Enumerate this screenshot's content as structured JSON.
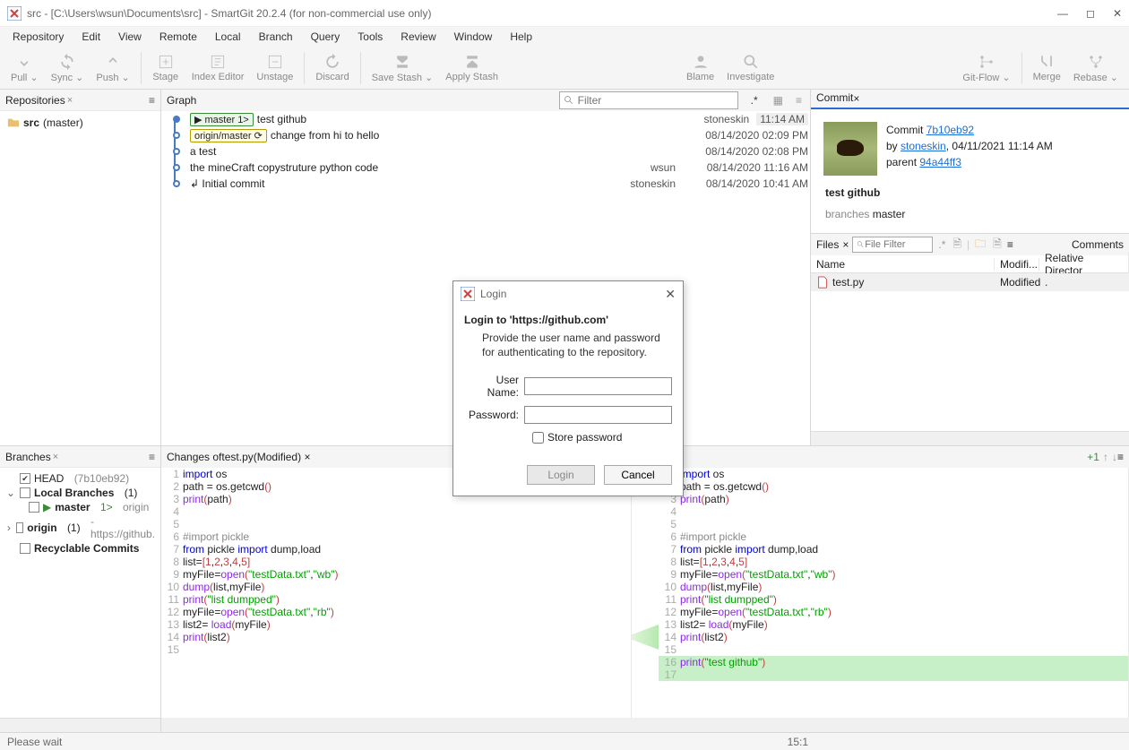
{
  "window": {
    "title": "src - [C:\\Users\\wsun\\Documents\\src] - SmartGit 20.2.4 (for non-commercial use only)"
  },
  "menu": [
    "Repository",
    "Edit",
    "View",
    "Remote",
    "Local",
    "Branch",
    "Query",
    "Tools",
    "Review",
    "Window",
    "Help"
  ],
  "toolbar": {
    "pull": "Pull ⌄",
    "sync": "Sync ⌄",
    "push": "Push ⌄",
    "stage": "Stage",
    "index_editor": "Index Editor",
    "unstage": "Unstage",
    "discard": "Discard",
    "save_stash": "Save Stash ⌄",
    "apply_stash": "Apply Stash",
    "blame": "Blame",
    "investigate": "Investigate",
    "gitflow": "Git-Flow ⌄",
    "merge": "Merge",
    "rebase": "Rebase ⌄"
  },
  "repositories": {
    "title": "Repositories",
    "items": [
      {
        "name": "src",
        "branch": "(master)"
      }
    ]
  },
  "graph": {
    "title": "Graph",
    "filter_placeholder": "Filter",
    "time_badge": "11:14 AM",
    "commits": [
      {
        "tags": [
          "▶ master 1>"
        ],
        "msg": "test github",
        "author": "stoneskin",
        "date": ""
      },
      {
        "tags": [
          "origin/master ⟳"
        ],
        "msg": "change from hi to hello",
        "author": "",
        "date": "08/14/2020 02:09 PM"
      },
      {
        "tags": [],
        "msg": "a test",
        "author": "",
        "date": "08/14/2020 02:08 PM"
      },
      {
        "tags": [],
        "msg": "the mineCraft copystruture python code",
        "author": "wsun",
        "date": "08/14/2020 11:16 AM"
      },
      {
        "tags": [],
        "msg": "↲ Initial commit",
        "author": "stoneskin",
        "date": "08/14/2020 10:41 AM"
      }
    ]
  },
  "commit_panel": {
    "title": "Commit",
    "commit_label": "Commit",
    "commit_hash": "7b10eb92",
    "by_label": "by",
    "author": "stoneskin",
    "date": ", 04/11/2021 11:14 AM",
    "parent_label": "parent",
    "parent_hash": "94a44ff3",
    "subject": "test github",
    "branches_label": "branches",
    "branches_value": "master"
  },
  "files_panel": {
    "title": "Files",
    "filter_placeholder": "File Filter",
    "dotstar": ".*",
    "comments": "Comments",
    "cols": {
      "name": "Name",
      "modifi": "Modifi...",
      "reldir": "Relative Director"
    },
    "rows": [
      {
        "name": "test.py",
        "status": "Modified",
        "reldir": "."
      }
    ]
  },
  "branches": {
    "title": "Branches",
    "head": {
      "label": "HEAD",
      "hash": "(7b10eb92)"
    },
    "local": {
      "label": "Local Branches",
      "count": "(1)"
    },
    "master": {
      "label": "master",
      "ahead": "1>",
      "remote": "origin"
    },
    "origin": {
      "label": "origin",
      "count": "(1)",
      "url": "- https://github."
    },
    "recyclable": "Recyclable Commits"
  },
  "changes": {
    "title_prefix": "Changes of ",
    "file": "test.py",
    "status": " (Modified)",
    "plus_count": "+1"
  },
  "diff": {
    "left": [
      {
        "n": 1,
        "html": "<span class='tok-kw'>import</span> os"
      },
      {
        "n": 2,
        "html": "path = os.getcwd<span class='tok-paren'>()</span>"
      },
      {
        "n": 3,
        "html": "<span class='tok-fn'>print</span><span class='tok-paren'>(</span>path<span class='tok-paren'>)</span>"
      },
      {
        "n": 4,
        "html": ""
      },
      {
        "n": 5,
        "html": ""
      },
      {
        "n": 6,
        "html": "<span class='tok-cmt'>#import pickle</span>"
      },
      {
        "n": 7,
        "html": "<span class='tok-kw'>from</span> pickle <span class='tok-kw'>import</span> dump,load"
      },
      {
        "n": 8,
        "html": "list=<span class='tok-paren'>[</span><span class='tok-num'>1</span>,<span class='tok-num'>2</span>,<span class='tok-num'>3</span>,<span class='tok-num'>4</span>,<span class='tok-num'>5</span><span class='tok-paren'>]</span>"
      },
      {
        "n": 9,
        "html": "myFile=<span class='tok-fn'>open</span><span class='tok-paren'>(</span><span class='tok-str'>\"testData.txt\"</span>,<span class='tok-str'>\"wb\"</span><span class='tok-paren'>)</span>"
      },
      {
        "n": 10,
        "html": "<span class='tok-fn'>dump</span><span class='tok-paren'>(</span>list,myFile<span class='tok-paren'>)</span>"
      },
      {
        "n": 11,
        "html": "<span class='tok-fn'>print</span><span class='tok-paren'>(</span><span class='tok-str'>\"list dumpped\"</span><span class='tok-paren'>)</span>"
      },
      {
        "n": 12,
        "html": "myFile=<span class='tok-fn'>open</span><span class='tok-paren'>(</span><span class='tok-str'>\"testData.txt\"</span>,<span class='tok-str'>\"rb\"</span><span class='tok-paren'>)</span>"
      },
      {
        "n": 13,
        "html": "list2= <span class='tok-fn'>load</span><span class='tok-paren'>(</span>myFile<span class='tok-paren'>)</span>"
      },
      {
        "n": 14,
        "html": "<span class='tok-fn'>print</span><span class='tok-paren'>(</span>list2<span class='tok-paren'>)</span>"
      },
      {
        "n": 15,
        "html": ""
      }
    ],
    "right": [
      {
        "n": 1,
        "html": "<span class='tok-kw'>import</span> os"
      },
      {
        "n": 2,
        "html": "path = os.getcwd<span class='tok-paren'>()</span>"
      },
      {
        "n": 3,
        "html": "<span class='tok-fn'>print</span><span class='tok-paren'>(</span>path<span class='tok-paren'>)</span>"
      },
      {
        "n": 4,
        "html": ""
      },
      {
        "n": 5,
        "html": ""
      },
      {
        "n": 6,
        "html": "<span class='tok-cmt'>#import pickle</span>"
      },
      {
        "n": 7,
        "html": "<span class='tok-kw'>from</span> pickle <span class='tok-kw'>import</span> dump,load"
      },
      {
        "n": 8,
        "html": "list=<span class='tok-paren'>[</span><span class='tok-num'>1</span>,<span class='tok-num'>2</span>,<span class='tok-num'>3</span>,<span class='tok-num'>4</span>,<span class='tok-num'>5</span><span class='tok-paren'>]</span>"
      },
      {
        "n": 9,
        "html": "myFile=<span class='tok-fn'>open</span><span class='tok-paren'>(</span><span class='tok-str'>\"testData.txt\"</span>,<span class='tok-str'>\"wb\"</span><span class='tok-paren'>)</span>"
      },
      {
        "n": 10,
        "html": "<span class='tok-fn'>dump</span><span class='tok-paren'>(</span>list,myFile<span class='tok-paren'>)</span>"
      },
      {
        "n": 11,
        "html": "<span class='tok-fn'>print</span><span class='tok-paren'>(</span><span class='tok-str'>\"list dumpped\"</span><span class='tok-paren'>)</span>"
      },
      {
        "n": 12,
        "html": "myFile=<span class='tok-fn'>open</span><span class='tok-paren'>(</span><span class='tok-str'>\"testData.txt\"</span>,<span class='tok-str'>\"rb\"</span><span class='tok-paren'>)</span>"
      },
      {
        "n": 13,
        "html": "list2= <span class='tok-fn'>load</span><span class='tok-paren'>(</span>myFile<span class='tok-paren'>)</span>"
      },
      {
        "n": 14,
        "html": "<span class='tok-fn'>print</span><span class='tok-paren'>(</span>list2<span class='tok-paren'>)</span>"
      },
      {
        "n": 15,
        "html": ""
      },
      {
        "n": 16,
        "html": "<span class='tok-fn'>print</span><span class='tok-paren'>(</span><span class='tok-str'>\"test github\"</span><span class='tok-paren'>)</span>",
        "cls": "line-added"
      },
      {
        "n": 17,
        "html": "",
        "cls": "line-added"
      }
    ]
  },
  "status": {
    "msg": "Please wait",
    "pos": "15:1"
  },
  "dialog": {
    "title": "Login",
    "heading": "Login to 'https://github.com'",
    "desc": "Provide the user name and password for authenticating to the repository.",
    "user_label": "User Name:",
    "pass_label": "Password:",
    "store_label": "Store password",
    "login_btn": "Login",
    "cancel_btn": "Cancel"
  }
}
